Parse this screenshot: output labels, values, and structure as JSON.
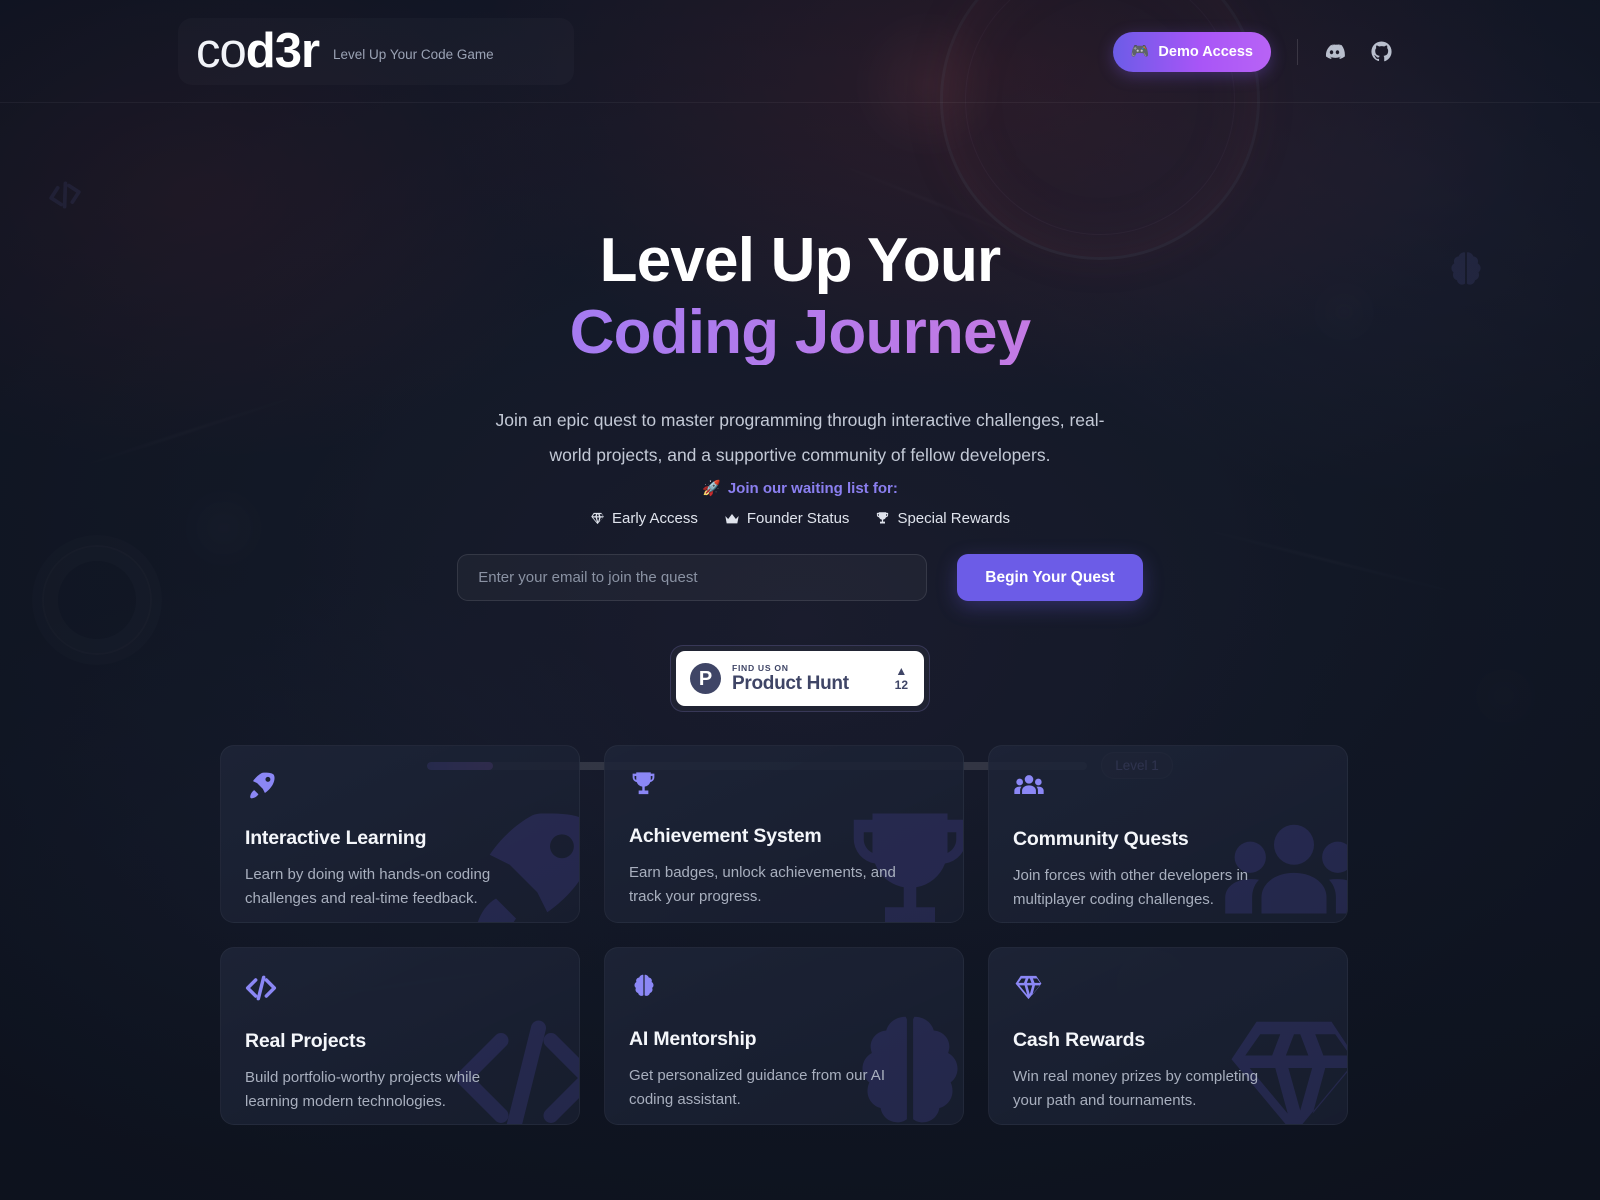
{
  "header": {
    "logo_light": "co",
    "logo_bold": "d3r",
    "tagline": "Level Up Your Code Game",
    "demo_emoji": "🎮",
    "demo_label": "Demo Access",
    "discord_icon": "discord-icon",
    "github_icon": "github-icon"
  },
  "hero": {
    "title_line1": "Level Up Your",
    "title_line2": "Coding Journey",
    "subtitle": "Join an epic quest to master programming through interactive challenges, real-world projects, and a supportive community of fellow developers.",
    "waitlist_emoji": "🚀",
    "waitlist_text": "Join our waiting list for:",
    "perks": [
      {
        "icon": "gem-icon",
        "label": "Early Access"
      },
      {
        "icon": "crown-icon",
        "label": "Founder Status"
      },
      {
        "icon": "trophy-icon",
        "label": "Special Rewards"
      }
    ],
    "email_placeholder": "Enter your email to join the quest",
    "email_value": "",
    "submit_label": "Begin Your Quest"
  },
  "product_hunt": {
    "logo_letter": "P",
    "eyebrow": "FIND US ON",
    "name": "Product Hunt",
    "caret": "▲",
    "votes": "12"
  },
  "progress": {
    "percent": 10,
    "level_label": "Level 1"
  },
  "features": [
    {
      "icon": "rocket-icon",
      "title": "Interactive Learning",
      "desc": "Learn by doing with hands-on coding challenges and real-time feedback."
    },
    {
      "icon": "trophy-icon",
      "title": "Achievement System",
      "desc": "Earn badges, unlock achievements, and track your progress."
    },
    {
      "icon": "users-icon",
      "title": "Community Quests",
      "desc": "Join forces with other developers in multiplayer coding challenges."
    },
    {
      "icon": "code-icon",
      "title": "Real Projects",
      "desc": "Build portfolio-worthy projects while learning modern technologies."
    },
    {
      "icon": "brain-icon",
      "title": "AI Mentorship",
      "desc": "Get personalized guidance from our AI coding assistant."
    },
    {
      "icon": "gem-icon",
      "title": "Cash Rewards",
      "desc": "Win real money prizes by completing your path and tournaments."
    }
  ],
  "decor": {
    "left_icon": "code-icon",
    "right_icon": "brain-icon"
  },
  "colors": {
    "accent": "#6c5ce7",
    "accent_light": "#8b87f5",
    "gradient_start": "#8f7ef5",
    "gradient_end": "#ec7fc8",
    "page_bg": "#121827",
    "card_bg": "#1e2538"
  }
}
